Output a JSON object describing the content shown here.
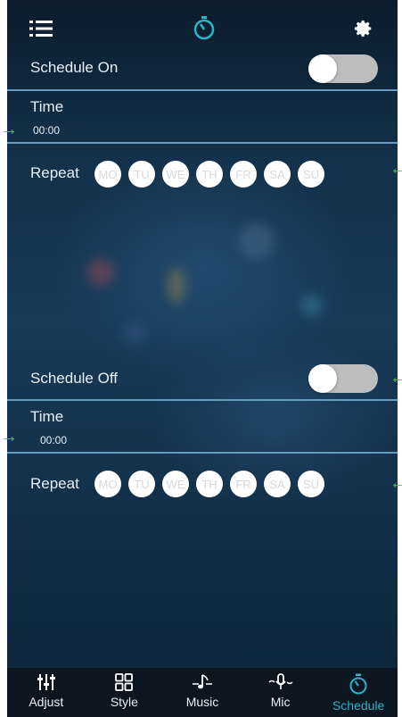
{
  "schedule_on": {
    "label": "Schedule On",
    "time_label": "Time",
    "time_value": "00:00",
    "repeat_label": "Repeat",
    "toggle_on": false
  },
  "schedule_off": {
    "label": "Schedule Off",
    "time_label": "Time",
    "time_value": "00:00",
    "repeat_label": "Repeat",
    "toggle_on": false
  },
  "days": [
    "MO",
    "TU",
    "WE",
    "TH",
    "FR",
    "SA",
    "SU"
  ],
  "nav": {
    "items": [
      {
        "label": "Adjust",
        "icon": "sliders-icon"
      },
      {
        "label": "Style",
        "icon": "grid-icon"
      },
      {
        "label": "Music",
        "icon": "music-note-icon"
      },
      {
        "label": "Mic",
        "icon": "microphone-icon"
      },
      {
        "label": "Schedule",
        "icon": "timer-icon"
      }
    ],
    "active": "Schedule"
  },
  "colors": {
    "accent": "#2ab3c9",
    "divider": "#4d8fb8",
    "annotation_arrow": "#5fbf3a"
  }
}
